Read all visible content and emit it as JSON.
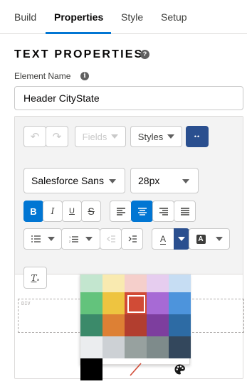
{
  "tabs": [
    {
      "label": "Build"
    },
    {
      "label": "Properties"
    },
    {
      "label": "Style"
    },
    {
      "label": "Setup"
    }
  ],
  "section_title": "TEXT PROPERTIES",
  "help_icon_glyph": "?",
  "element_name": {
    "label": "Element Name",
    "info_glyph": "i",
    "value": "Header CityState"
  },
  "toolbar": {
    "undo_glyph": "↶",
    "redo_glyph": "↷",
    "fields_label": "Fields",
    "styles_label": "Styles",
    "more_glyph": "••",
    "font_family": "Salesforce Sans",
    "font_size": "28px",
    "bold_glyph": "B",
    "italic_glyph": "I",
    "underline_glyph": "U",
    "strike_glyph": "S",
    "text_color_glyph": "A",
    "highlight_glyph": "A",
    "clear_format_glyph": "T"
  },
  "canvas": {
    "tag_label": "DIV"
  },
  "palette": {
    "accent": "#0176d3",
    "rows": [
      [
        "#c3e6cf",
        "#f9eab0",
        "#f5cfcb",
        "#e6cdef",
        "#c6ddf3"
      ],
      [
        "#63c37c",
        "#eec440",
        "#d14b36",
        "#a76ad5",
        "#4d94dc"
      ],
      [
        "#3b8a6a",
        "#dd8034",
        "#b23e2f",
        "#7d3e9e",
        "#2d6ba4"
      ],
      [
        "#ebedef",
        "#cdd1d5",
        "#97a19f",
        "#7e8b8b",
        "#33475c"
      ]
    ],
    "selected": "#d14b36",
    "bottom": [
      "#000000",
      "no-color-icon",
      "palette-icon"
    ]
  }
}
